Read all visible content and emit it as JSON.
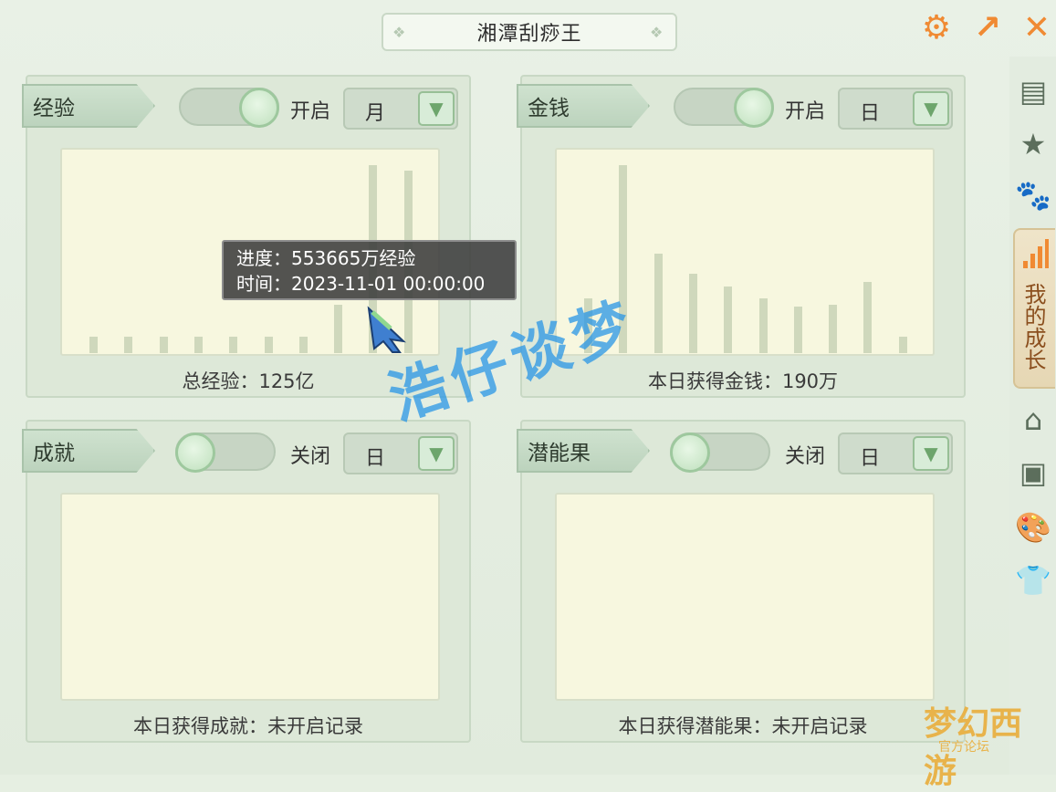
{
  "window": {
    "title": "湘潭刮痧王"
  },
  "controls": {
    "settings_icon": "gear-icon",
    "popout_icon": "popout-arrow-icon",
    "close_icon": "close-x-icon",
    "accent": "#f08a33"
  },
  "panels": {
    "exp": {
      "tab": "经验",
      "toggle_state": "on",
      "toggle_label": "开启",
      "period": "月",
      "summary": "总经验：125亿",
      "tooltip": {
        "line1": "进度：553665万经验",
        "line2": "时间：2023-11-01 00:00:00"
      },
      "bar_values": [
        0.08,
        0.08,
        0.08,
        0.08,
        0.08,
        0.08,
        0.08,
        0.24,
        0.93,
        0.9
      ]
    },
    "money": {
      "tab": "金钱",
      "toggle_state": "on",
      "toggle_label": "开启",
      "period": "日",
      "summary": "本日获得金钱：190万",
      "bar_values": [
        0.27,
        0.93,
        0.49,
        0.39,
        0.33,
        0.27,
        0.23,
        0.24,
        0.35,
        0.08
      ]
    },
    "achievement": {
      "tab": "成就",
      "toggle_state": "off",
      "toggle_label": "关闭",
      "period": "日",
      "summary": "本日获得成就：未开启记录"
    },
    "potential": {
      "tab": "潜能果",
      "toggle_state": "off",
      "toggle_label": "关闭",
      "period": "日",
      "summary": "本日获得潜能果：未开启记录"
    }
  },
  "sidebar": {
    "items": [
      {
        "icon": "chat-icon"
      },
      {
        "icon": "star-icon"
      },
      {
        "icon": "paw-icon"
      },
      {
        "icon": "growth-bars-icon",
        "label": "我的成长",
        "active": true
      },
      {
        "icon": "house-icon"
      },
      {
        "icon": "storage-box-icon"
      },
      {
        "icon": "palette-icon"
      },
      {
        "icon": "shirt-icon"
      }
    ]
  },
  "overlay": {
    "watermark": "浩仔谈梦",
    "logo_text": "梦幻西游",
    "logo_sub": "官方论坛"
  }
}
